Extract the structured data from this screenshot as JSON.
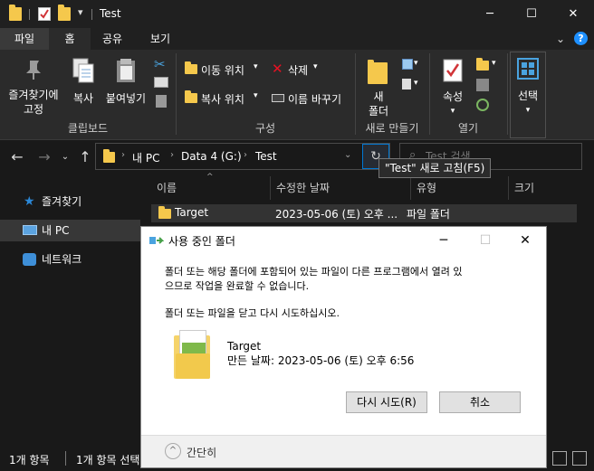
{
  "window": {
    "title": "Test",
    "minimize_icon": "minimize-icon",
    "maximize_icon": "maximize-icon",
    "close_icon": "close-icon"
  },
  "ribbon_tabs": [
    "파일",
    "홈",
    "공유",
    "보기"
  ],
  "ribbon": {
    "clipboard": {
      "pin_label_1": "즐겨찾기에",
      "pin_label_2": "고정",
      "copy_label": "복사",
      "paste_label": "붙여넣기",
      "group_label": "클립보드"
    },
    "organize": {
      "move_to": "이동 위치",
      "copy_to": "복사 위치",
      "delete": "삭제",
      "rename": "이름 바꾸기",
      "group_label": "구성"
    },
    "new": {
      "new_folder_1": "새",
      "new_folder_2": "폴더",
      "group_label": "새로 만들기"
    },
    "open": {
      "properties": "속성",
      "group_label": "열기"
    },
    "select": {
      "label": "선택"
    }
  },
  "address": {
    "breadcrumb": [
      "내 PC",
      "Data 4 (G:)",
      "Test"
    ],
    "search_placeholder": "Test 검색",
    "refresh_tooltip": "\"Test\" 새로 고침(F5)"
  },
  "nav_pane": [
    {
      "label": "즐겨찾기",
      "icon": "star-icon"
    },
    {
      "label": "내 PC",
      "icon": "pc-icon"
    },
    {
      "label": "네트워크",
      "icon": "network-icon"
    }
  ],
  "file_list": {
    "columns": [
      "이름",
      "수정한 날짜",
      "유형",
      "크기"
    ],
    "rows": [
      {
        "name": "Target",
        "modified": "2023-05-06 (토) 오후 ...",
        "type": "파일 폴더",
        "size": ""
      }
    ]
  },
  "status": {
    "item_count": "1개 항목",
    "selected": "1개 항목 선택"
  },
  "dialog": {
    "title": "사용 중인 폴더",
    "message_line1": "폴더 또는 해당 폴더에 포함되어 있는 파일이 다른 프로그램에서 열려 있",
    "message_line2": "으므로 작업을 완료할 수 없습니다.",
    "instruction": "폴더 또는 파일을 닫고 다시 시도하십시오.",
    "item_name": "Target",
    "item_created": "만든 날짜: 2023-05-06 (토) 오후 6:56",
    "retry_button": "다시 시도(R)",
    "cancel_button": "취소",
    "collapse_label": "간단히"
  },
  "colors": {
    "accent": "#0078d4",
    "folder": "#f5c84c",
    "dark_bg": "#191919"
  }
}
